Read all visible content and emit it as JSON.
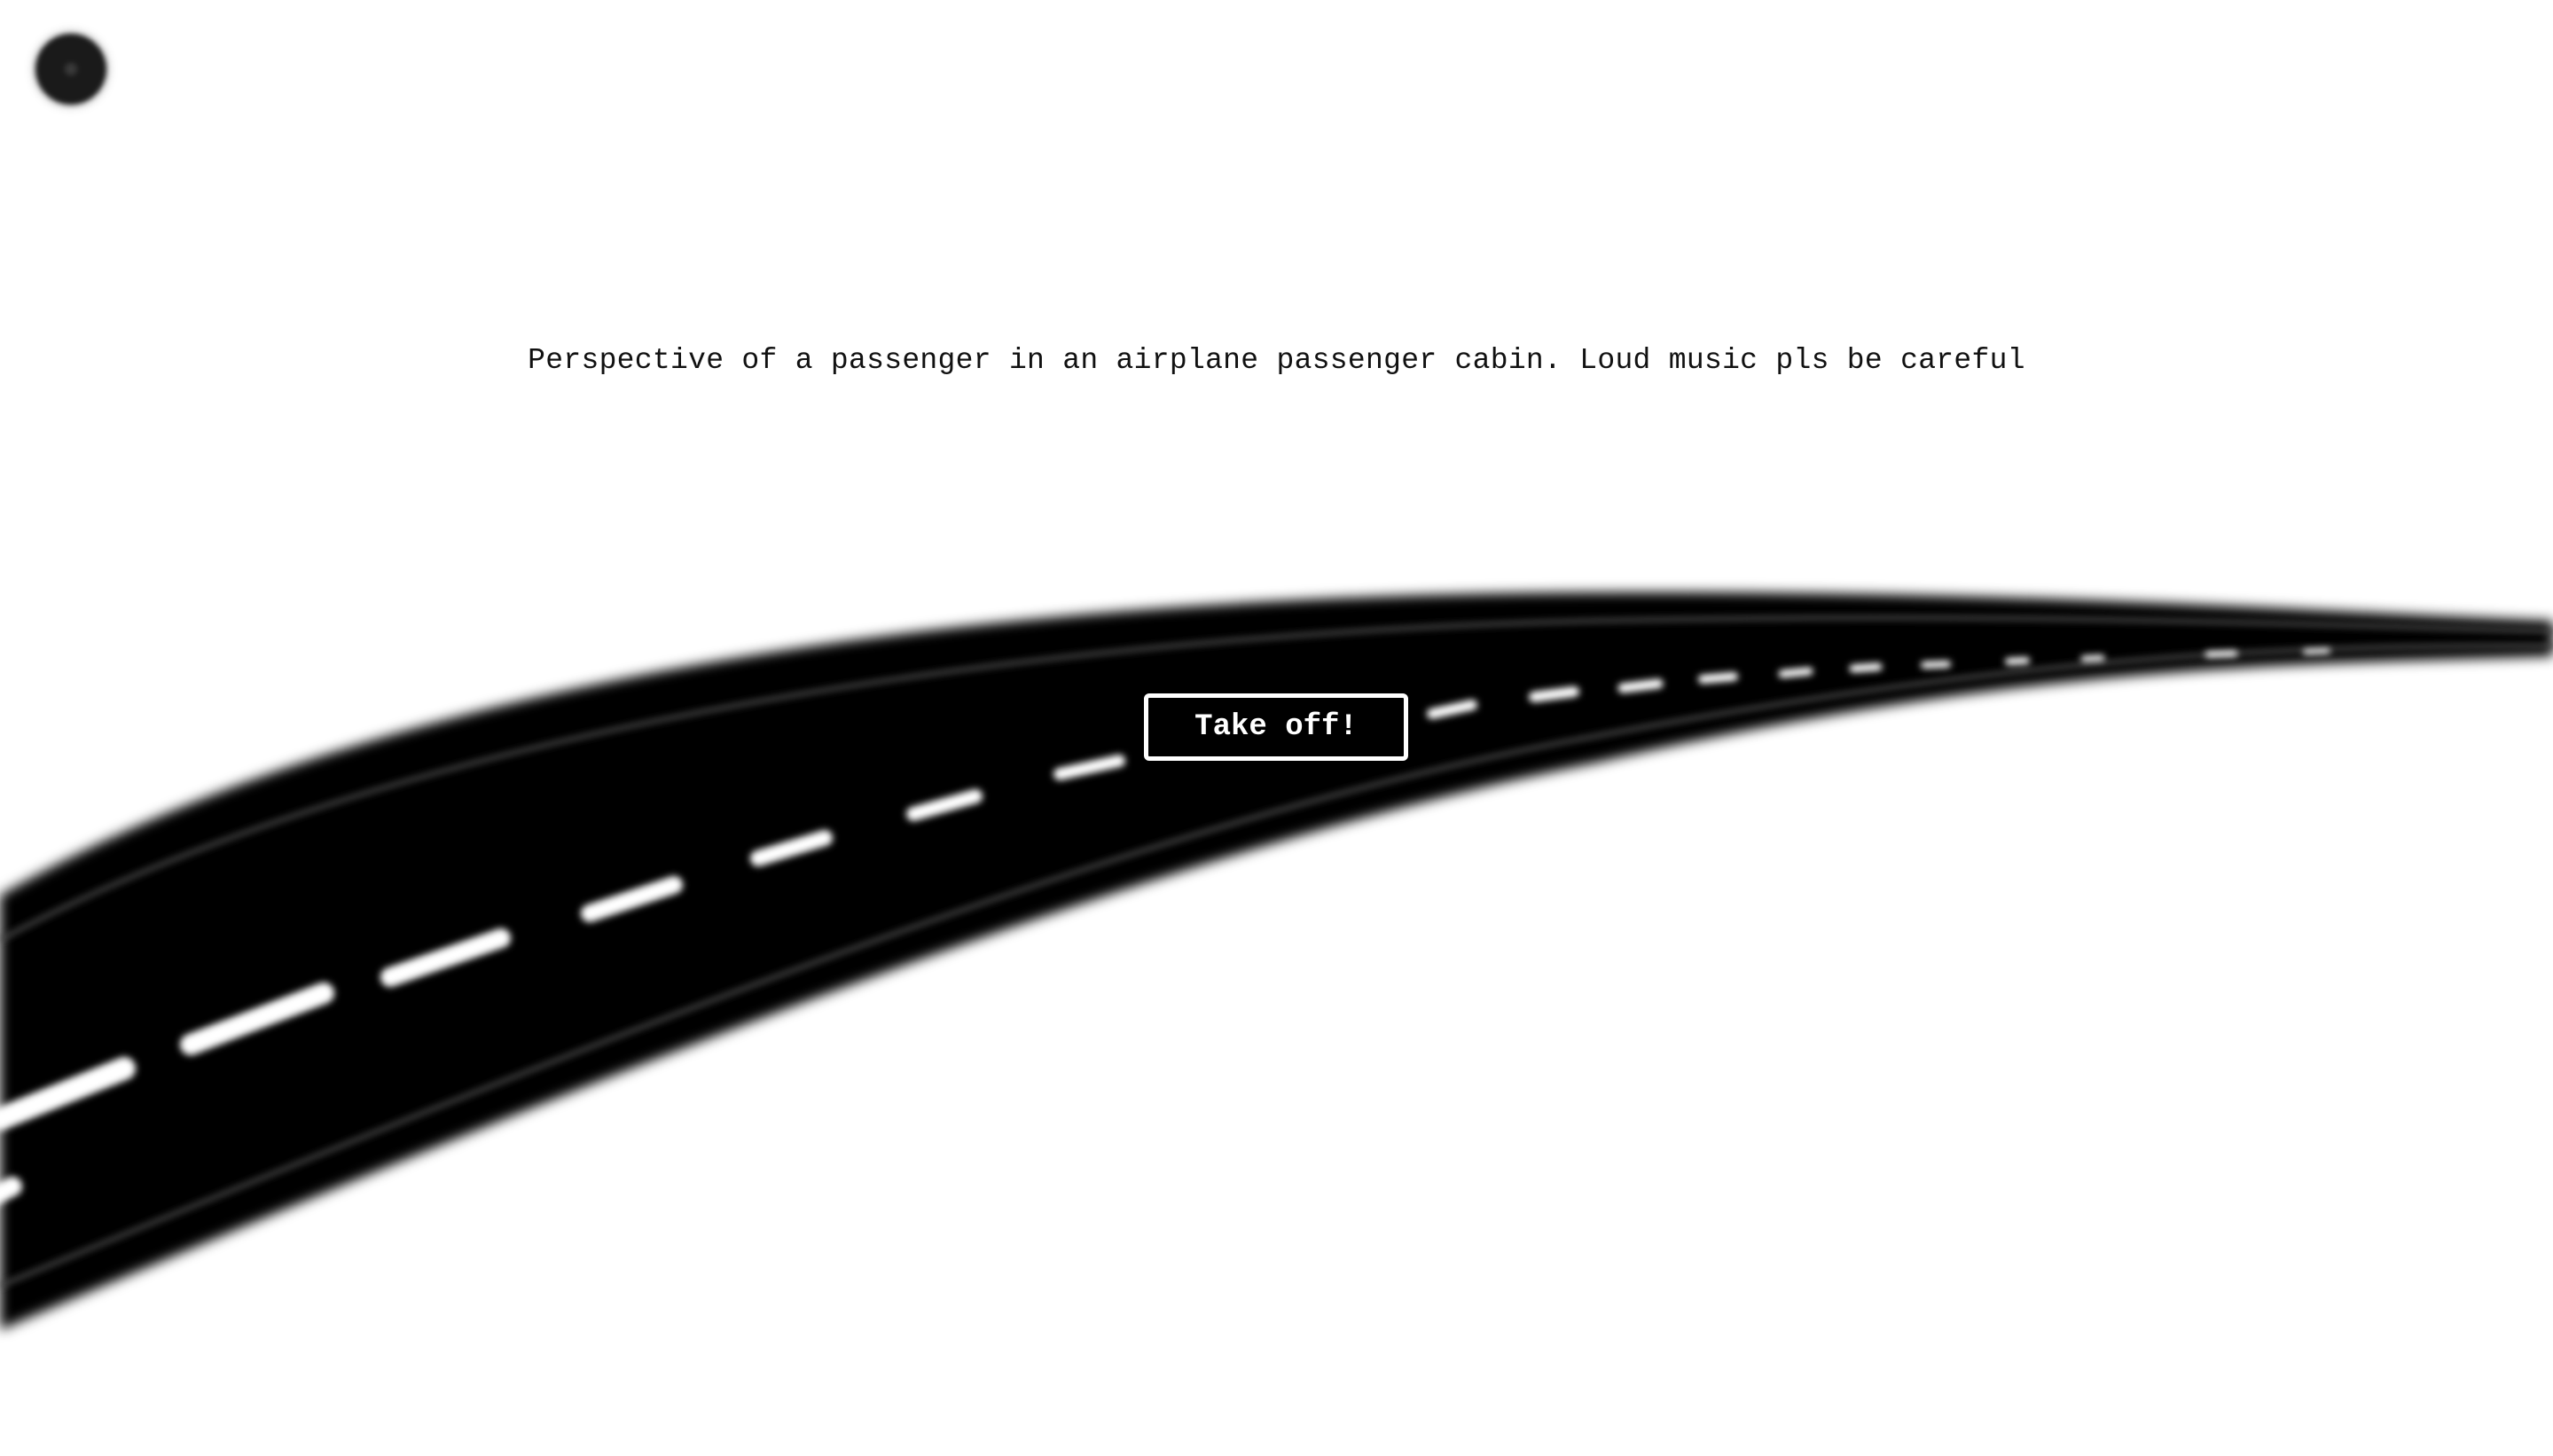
{
  "page": {
    "caption": "Perspective of a passenger in an airplane passenger cabin. Loud music pls be careful"
  },
  "controls": {
    "takeoff_label": "Take off!"
  },
  "colors": {
    "background": "#ffffff",
    "runway": "#000000",
    "runway_markings": "#ffffff",
    "button_background": "#000000",
    "button_text": "#ffffff"
  }
}
